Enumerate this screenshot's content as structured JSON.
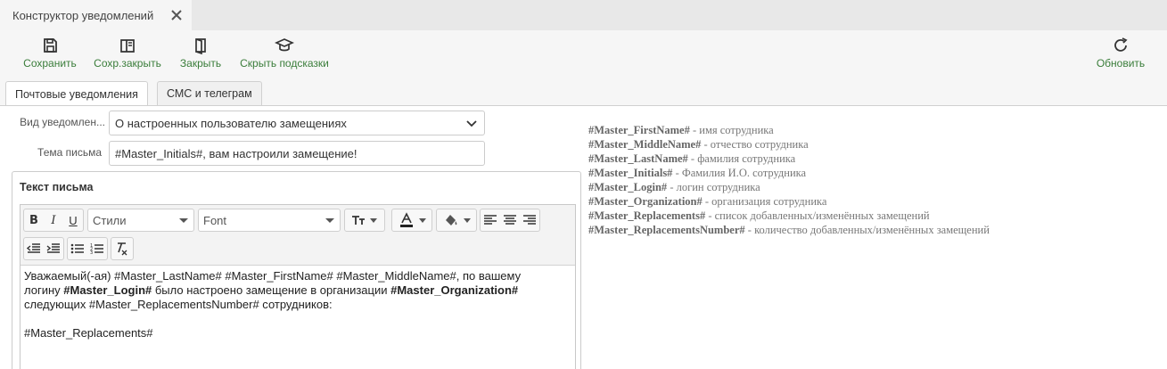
{
  "window_tab": {
    "title": "Конструктор уведомлений"
  },
  "toolbar": {
    "save": "Сохранить",
    "save_close": "Сохр.закрыть",
    "close": "Закрыть",
    "hide_hints": "Скрыть подсказки",
    "refresh": "Обновить"
  },
  "tabs": {
    "email": "Почтовые уведомления",
    "sms": "СМС и телеграм"
  },
  "form": {
    "type_label": "Вид уведомлен...",
    "type_value": "О настроенных пользователю замещениях",
    "subject_label": "Тема письма",
    "subject_value": "#Master_Initials#, вам настроили замещение!"
  },
  "editor": {
    "title": "Текст письма",
    "styles_placeholder": "Стили",
    "font_placeholder": "Font",
    "body": {
      "line1_a": "Уважаемый(-ая) #Master_LastName# #Master_FirstName# #Master_MiddleName#, по вашему",
      "line2_a": "логину ",
      "line2_b": "#Master_Login#",
      "line2_c": " было настроено замещение в организации ",
      "line2_d": "#Master_Organization#",
      "line3": "следующих #Master_ReplacementsNumber# сотрудников:",
      "line5": "#Master_Replacements#"
    }
  },
  "hints": [
    {
      "key": "#Master_FirstName#",
      "desc": " - имя сотрудника"
    },
    {
      "key": "#Master_MiddleName#",
      "desc": " - отчество сотрудника"
    },
    {
      "key": "#Master_LastName#",
      "desc": " - фамилия сотрудника"
    },
    {
      "key": "#Master_Initials#",
      "desc": " - Фамилия И.О. сотрудника"
    },
    {
      "key": "#Master_Login#",
      "desc": " - логин сотрудника"
    },
    {
      "key": "#Master_Organization#",
      "desc": " - организация сотрудника"
    },
    {
      "key": "#Master_Replacements#",
      "desc": " - список добавленных/изменённых замещений"
    },
    {
      "key": "#Master_ReplacementsNumber#",
      "desc": " - количество добавленных/изменённых замещений"
    }
  ],
  "colors": {
    "accent_green": "#3a7d3a"
  }
}
